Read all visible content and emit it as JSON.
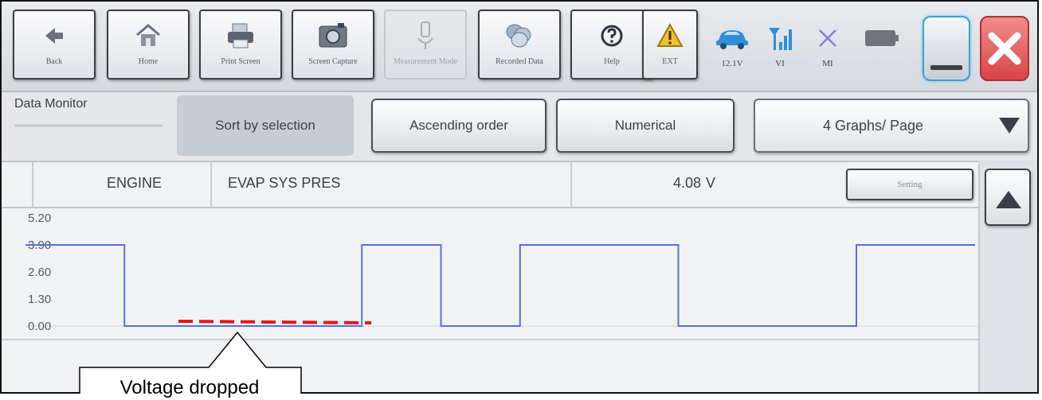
{
  "toolbar": {
    "buttons": [
      {
        "label": "Back",
        "icon": "back-arrow-icon"
      },
      {
        "label": "Home",
        "icon": "home-icon"
      },
      {
        "label": "Print Screen",
        "icon": "printer-icon"
      },
      {
        "label": "Screen Capture",
        "icon": "camera-icon"
      },
      {
        "label": "Measurement Mode",
        "icon": "measurement-icon",
        "enabled": false
      },
      {
        "label": "Recorded Data",
        "icon": "recorded-data-icon"
      },
      {
        "label": "Help",
        "icon": "help-icon"
      },
      {
        "label": "EXT",
        "icon": "warning-icon"
      }
    ],
    "status": [
      {
        "label": "12.1V",
        "icon": "car-battery-icon"
      },
      {
        "label": "VI",
        "icon": "signal-icon"
      },
      {
        "label": "MI",
        "icon": "disconnected-icon"
      }
    ],
    "battery_icon": "battery-icon"
  },
  "controls": {
    "title": "Data Monitor",
    "sort_selection": "Sort by selection",
    "ascending": "Ascending order",
    "numerical": "Numerical",
    "graphs_per_page": "4 Graphs/ Page"
  },
  "graph": {
    "system": "ENGINE",
    "item": "EVAP SYS PRES",
    "value": "4.08",
    "unit": "V",
    "setting_label": "Setting",
    "y_ticks": [
      "5.20",
      "3.90",
      "2.60",
      "1.30",
      "0.00"
    ]
  },
  "annotation": {
    "text": "Voltage dropped",
    "color": "#e8141c"
  },
  "colors": {
    "trace": "#4f74d6",
    "close": "#d84545",
    "accent": "#38a3d6"
  },
  "chart_data": {
    "type": "line",
    "title": "",
    "xlabel": "",
    "ylabel": "",
    "ylim": [
      0,
      5.2
    ],
    "y_ticks": [
      0,
      1.3,
      2.6,
      3.9,
      5.2
    ],
    "series": [
      {
        "values": [
          3.9,
          3.9,
          3.9,
          3.9,
          3.9,
          0.0,
          0.0,
          0.0,
          0.0,
          0.0,
          0.0,
          0.0,
          0.0,
          0.0,
          0.0,
          0.0,
          0.0,
          3.9,
          3.9,
          3.9,
          3.9,
          0.0,
          0.0,
          0.0,
          0.0,
          3.9,
          3.9,
          3.9,
          3.9,
          3.9,
          3.9,
          3.9,
          3.9,
          0.0,
          0.0,
          0.0,
          0.0,
          0.0,
          0.0,
          0.0,
          0.0,
          0.0,
          3.9,
          3.9,
          3.9,
          3.9,
          3.9,
          3.9
        ]
      }
    ]
  }
}
